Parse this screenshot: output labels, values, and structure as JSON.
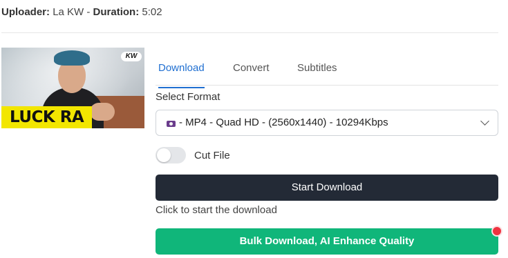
{
  "meta": {
    "uploader_label": "Uploader:",
    "uploader_value": "La KW",
    "separator": "-",
    "duration_label": "Duration:",
    "duration_value": "5:02"
  },
  "thumbnail": {
    "banner_text": "LUCK RA",
    "logo_text": "KW"
  },
  "tabs": [
    {
      "label": "Download",
      "active": true
    },
    {
      "label": "Convert",
      "active": false
    },
    {
      "label": "Subtitles",
      "active": false
    }
  ],
  "format": {
    "label": "Select Format",
    "selected": "- MP4 - Quad HD - (2560x1440) - 10294Kbps",
    "icon": "video-file-icon"
  },
  "cut_file": {
    "label": "Cut File",
    "enabled": false
  },
  "start_button": {
    "label": "Start Download",
    "hint": "Click to start the download"
  },
  "bulk_button": {
    "label": "Bulk Download, AI Enhance Quality"
  },
  "colors": {
    "accent": "#1f6fd1",
    "primary_button": "#232a36",
    "bulk_button": "#10b67a",
    "notification": "#ef3340"
  }
}
